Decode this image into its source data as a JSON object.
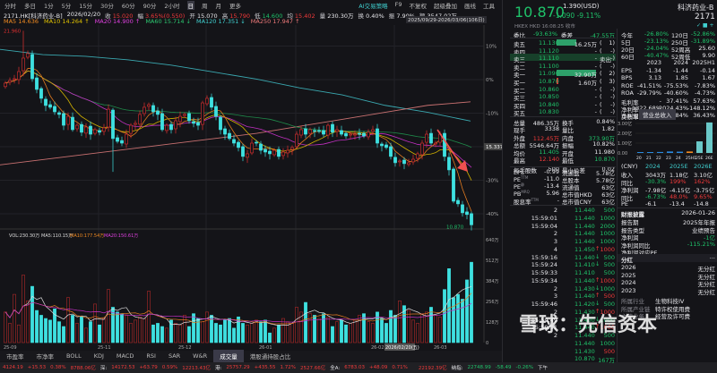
{
  "toolbar": {
    "periods": [
      "分时",
      "多日",
      "1分",
      "5分",
      "15分",
      "30分",
      "60分",
      "90分",
      "2小时",
      "日",
      "周",
      "月",
      "更多"
    ],
    "active": "日",
    "right": [
      "AI交易策略",
      "F9",
      "不复权",
      "超级叠加",
      "画线",
      "工具"
    ]
  },
  "info": {
    "symbol": "2171.HK[科济药业-B]",
    "date": "2026/02/20",
    "close_label": "收",
    "close": "15.020",
    "chg_label": "幅",
    "chg": "3.65%(0.550)",
    "open_label": "开",
    "open": "15.070",
    "high_label": "高",
    "high": "15.790",
    "low_label": "低",
    "low": "14.600",
    "avg_label": "均",
    "avg": "15.402",
    "vol_label": "量",
    "vol": "230.30万",
    "turn_label": "换",
    "turn": "0.40%",
    "amp_label": "振",
    "amp": "7.90%",
    "amt_label": "额",
    "amt": "3547.02万"
  },
  "ma_legend": [
    {
      "t": "MA5 14.636",
      "c": "#f08a20"
    },
    {
      "t": "MA10 14.264 ↑",
      "c": "#e0c200"
    },
    {
      "t": "MA20 14.900 ↑",
      "c": "#e040e0"
    },
    {
      "t": "MA60 15.714 ↓",
      "c": "#2cc870"
    },
    {
      "t": "MA120 17.351 ↓",
      "c": "#40d0d0"
    },
    {
      "t": "MA250 17.947 ↑",
      "c": "#f07a7a"
    }
  ],
  "range_label": "2025/09/29-2026/03/06(106日)",
  "colors": {
    "up": "#e03030",
    "down": "#3ee0e0",
    "bg": "#141418"
  },
  "chart_data": {
    "type": "candlestick",
    "base_price": 19.17,
    "high_marker": "21.960",
    "last_marker": "10.870",
    "current_price_label": "15.337",
    "pct_ticks": [
      "10%",
      "0%",
      "-10%",
      "-20%",
      "-30%",
      "-40%"
    ],
    "pct_values": [
      10,
      0,
      -10,
      -20,
      -30,
      -40
    ],
    "x_ticks": [
      "25-09",
      "25-11",
      "25-12",
      "26-01",
      "26-02",
      "26-03"
    ],
    "x_tick_index": [
      0,
      21,
      39,
      57,
      82,
      96
    ],
    "hover_date": "2026/02/20(五)",
    "hover_index": 88,
    "closes": [
      18.97,
      19.12,
      19.22,
      19.63,
      20.4,
      20.66,
      19.22,
      18.61,
      18.1,
      17.69,
      17.59,
      17.33,
      17.18,
      16.56,
      17.07,
      16.31,
      16.56,
      16.16,
      16.46,
      16.05,
      16.31,
      16.16,
      16.41,
      17.48,
      15.8,
      15.64,
      15.54,
      16.05,
      16.56,
      16.67,
      17.18,
      17.59,
      17.74,
      17.33,
      17.18,
      16.31,
      16.56,
      16.31,
      16.82,
      17.07,
      17.18,
      16.82,
      16.67,
      16.56,
      17.84,
      18.1,
      17.59,
      17.07,
      16.31,
      16.05,
      15.8,
      15.54,
      15.29,
      14.78,
      14.93,
      15.54,
      15.54,
      15.13,
      15.03,
      14.93,
      15.13,
      14.78,
      15.03,
      15.13,
      15.29,
      16.05,
      16.31,
      16.05,
      16.31,
      16.21,
      16.21,
      16.05,
      16.56,
      16.16,
      16.31,
      16.05,
      15.95,
      16.05,
      16.05,
      16.05,
      15.95,
      16.16,
      16.31,
      15.54,
      15.39,
      15.29,
      14.78,
      14.42,
      14.52,
      14.37,
      14.42,
      14.62,
      14.93,
      15.54,
      16.05,
      15.54,
      15.54,
      16.05,
      14.78,
      14.01,
      12.22,
      12.07,
      11.56,
      11.46,
      10.87
    ],
    "spike_index": 4,
    "spike_high": 21.96,
    "ma120": [
      20.9,
      20.6,
      20.5,
      20.3,
      20.0,
      19.6,
      19.2,
      18.7,
      18.3,
      17.7,
      17.3,
      16.8
    ],
    "ma250": [
      14.3,
      14.6,
      14.9,
      15.2,
      15.5,
      15.8,
      16.1,
      16.5,
      16.9,
      17.3,
      17.7,
      17.9
    ],
    "volume": {
      "title": "VOL:230.30万",
      "ma5": "MA5:110.15万",
      "ma10": "MA10:177.54万",
      "ma20": "MA20:150.61万",
      "ticks": [
        "640万",
        "512万",
        "384万",
        "256万",
        "128万",
        "0"
      ],
      "max": 640,
      "values": [
        190,
        120,
        300,
        110,
        420,
        260,
        350,
        200,
        170,
        150,
        140,
        210,
        130,
        100,
        280,
        170,
        120,
        160,
        90,
        130,
        240,
        110,
        150,
        330,
        220,
        190,
        180,
        170,
        120,
        140,
        160,
        150,
        320,
        110,
        120,
        100,
        90,
        140,
        120,
        110,
        170,
        100,
        180,
        150,
        130,
        190,
        170,
        120,
        110,
        140,
        150,
        90,
        160,
        120,
        110,
        120,
        140,
        130,
        140,
        60,
        90,
        110,
        150,
        130,
        120,
        220,
        190,
        250,
        180,
        170,
        150,
        180,
        160,
        100,
        130,
        140,
        110,
        120,
        140,
        170,
        180,
        130,
        120,
        190,
        150,
        120,
        200,
        170,
        260,
        230,
        200,
        140,
        120,
        180,
        190,
        220,
        170,
        160,
        330,
        460,
        280,
        300,
        270,
        390,
        500
      ]
    }
  },
  "tabs": {
    "items": [
      "市盈率",
      "市净率",
      "BOLL",
      "KDJ",
      "MACD",
      "RSI",
      "SAR",
      "W&R",
      "成交量",
      "港股通持股占比"
    ],
    "active": "成交量"
  },
  "ticker": [
    {
      "t": "4124.19",
      "c": "r"
    },
    {
      "t": "+15.53",
      "c": "r"
    },
    {
      "t": "0.38%",
      "c": "r"
    },
    {
      "t": "8788.06亿",
      "c": "r"
    },
    {
      "t": "深:",
      "c": "w"
    },
    {
      "t": "14172.53",
      "c": "r"
    },
    {
      "t": "+63.79",
      "c": "r"
    },
    {
      "t": "0.59%",
      "c": "r"
    },
    {
      "t": "12213.43亿",
      "c": "r"
    },
    {
      "t": "港:",
      "c": "w"
    },
    {
      "t": "25757.29",
      "c": "r"
    },
    {
      "t": "+435.55",
      "c": "r"
    },
    {
      "t": "1.72%",
      "c": "r"
    },
    {
      "t": "2527.66亿",
      "c": "r"
    },
    {
      "t": "全A:",
      "c": "w"
    },
    {
      "t": "6783.03",
      "c": "r"
    },
    {
      "t": "+48.09",
      "c": "r"
    },
    {
      "t": "0.71%",
      "c": "r"
    },
    {
      "t": "22192.39亿",
      "c": "r"
    },
    {
      "t": "纳指:",
      "c": "w"
    },
    {
      "t": "22748.99",
      "c": "g"
    },
    {
      "t": "-58.49",
      "c": "g"
    },
    {
      "t": "-0.26%",
      "c": "g"
    },
    {
      "t": "下午",
      "c": "w"
    }
  ],
  "quote": {
    "price": "10.870",
    "usd": "1.390(USD)",
    "change": "-1.090",
    "pct": "-9.11%",
    "name": "科济药业-B",
    "code": "2171",
    "market": "HKEX HKD 16:08:25 收市"
  },
  "book": {
    "wb_label": "委比",
    "wb": "-93.63%",
    "wc_label": "委差",
    "wc": "-47.55万",
    "asks": [
      [
        "卖五",
        "11.130",
        "16.25万",
        "(",
        "1)"
      ],
      [
        "卖四",
        "11.120",
        "-",
        "(",
        "-)"
      ],
      [
        "卖三",
        "11.110",
        "-",
        "卖出",
        "-)"
      ],
      [
        "卖二",
        "11.100",
        "-",
        "(",
        "-)"
      ],
      [
        "卖一",
        "11.090",
        "32.90万",
        "(",
        "2)"
      ]
    ],
    "bids": [
      [
        "买一",
        "10.870",
        "1.60万",
        "(",
        "3)"
      ],
      [
        "买二",
        "10.860",
        "-",
        "(",
        "-)"
      ],
      [
        "买三",
        "10.850",
        "-",
        "(",
        "-)"
      ],
      [
        "买四",
        "10.840",
        "-",
        "(",
        "-)"
      ],
      [
        "买五",
        "10.830",
        "-",
        "(",
        "-)"
      ]
    ]
  },
  "stats": [
    [
      "总量",
      "486.35万",
      "换手",
      "0.84%"
    ],
    [
      "现手",
      "3338",
      "量比",
      "1.82"
    ],
    [
      "外盘",
      "112.45万",
      "内盘",
      "373.90万"
    ],
    [
      "总额",
      "5546.64万",
      "振幅",
      "10.82%"
    ],
    [
      "均价",
      "11.405",
      "开盘",
      "11.980"
    ],
    [
      "最高",
      "12.140",
      "最低",
      "10.870"
    ],
    [
      "每手股数",
      "500",
      "最小价差",
      "0.02"
    ]
  ],
  "fund": [
    [
      "EPS",
      "TTM",
      "-0.99",
      "流通盘",
      "5.78亿"
    ],
    [
      "PE",
      "TTM",
      "-11.0",
      "总股本",
      "5.78亿"
    ],
    [
      "PE",
      "静",
      "-13.4",
      "流通值",
      "63亿"
    ],
    [
      "PB",
      "MRQ",
      "5.96",
      "总市值HKD",
      "63亿"
    ],
    [
      "股息率",
      "TTM",
      "-",
      "总市值CNY",
      "63亿"
    ]
  ],
  "trades": [
    [
      "2",
      "11.440",
      "",
      "500",
      "g"
    ],
    [
      "15:59:01",
      "11.440",
      "",
      "1000",
      "g"
    ],
    [
      "15:59:04",
      "11.440",
      "",
      "2000",
      "g"
    ],
    [
      "2",
      "11.440",
      "",
      "1000",
      "g"
    ],
    [
      "3",
      "11.440",
      "",
      "1000",
      "g"
    ],
    [
      "4",
      "11.450",
      "↑",
      "1000",
      "r"
    ],
    [
      "15:59:16",
      "11.440",
      "↓",
      "500",
      "g"
    ],
    [
      "15:59:24",
      "11.410",
      "↓",
      "500",
      "g"
    ],
    [
      "15:59:33",
      "11.410",
      "",
      "500",
      "g"
    ],
    [
      "15:59:34",
      "11.440",
      "↑",
      "1000",
      "r"
    ],
    [
      "2",
      "11.430",
      "↓",
      "1000",
      "g"
    ],
    [
      "3",
      "11.440",
      "↑",
      "500",
      "r"
    ],
    [
      "15:59:46",
      "11.420",
      "↓",
      "500",
      "g"
    ],
    [
      "2",
      "11.430",
      "↑",
      "1000",
      "r"
    ],
    [
      "15:59:49",
      "11.400",
      "↓",
      "1000",
      "g"
    ],
    [
      "15:59:51",
      "11.440",
      "↑",
      "1000",
      "r"
    ],
    [
      "2",
      "11.440",
      "",
      "500",
      "g"
    ],
    [
      "",
      "11.440",
      "",
      "1000",
      "g"
    ],
    [
      "",
      "11.430",
      "",
      "500",
      "r"
    ],
    [
      "",
      "10.870",
      "",
      "167万",
      "g"
    ]
  ],
  "perf": [
    [
      "今年",
      "-26.80%",
      "120日",
      "-52.86%"
    ],
    [
      "5日",
      "-23.13%",
      "250日",
      "-31.89%"
    ],
    [
      "20日",
      "-24.04%",
      "52周高",
      "25.60"
    ],
    [
      "60日",
      "-40.47%",
      "52周低",
      "9.90"
    ]
  ],
  "fin": {
    "headers": [
      "2023",
      "2024",
      "2025H1"
    ],
    "rows": [
      [
        "EPS",
        "-1.34",
        "-1.44",
        "-0.14"
      ],
      [
        "BPS",
        "3.13",
        "1.85",
        "1.67"
      ],
      [
        "ROE",
        "-41.51%",
        "-75.53%",
        "-7.83%"
      ],
      [
        "ROA",
        "-29.79%",
        "-40.60%",
        "-4.73%"
      ],
      [
        "毛利率",
        "-",
        "37.41%",
        "57.63%"
      ],
      [
        "净利率",
        "-1322.68%",
        "-2024.43%",
        "-148.12%"
      ],
      [
        "负债率",
        "20.18%",
        "36.84%",
        "36.43%"
      ]
    ],
    "np_label": "净利润",
    "rev_button": "营业总收入"
  },
  "rev_chart": {
    "type": "bar",
    "yticks": [
      "3.00亿",
      "2.00亿",
      "1.00亿",
      "0.00"
    ],
    "categories": [
      "20",
      "21",
      "22",
      "23",
      "24",
      "25H1",
      "25E",
      "26E"
    ],
    "values": [
      0.02,
      0.05,
      0.1,
      0.15,
      0.13,
      0.15,
      1.18,
      3.1
    ]
  },
  "forecast": {
    "headers": [
      "(CNY)",
      "2024",
      "2025E",
      "2026E"
    ],
    "rows": [
      [
        "收入",
        "3043万",
        "1.18亿",
        "3.10亿"
      ],
      [
        "同比",
        "-30.3%",
        "199%",
        "162%"
      ],
      [
        "净利润",
        "-7.98亿",
        "-4.15亿",
        "-3.75亿"
      ],
      [
        "同比",
        "-6.73%",
        "48.0%",
        "9.65%"
      ],
      [
        "PE",
        "-6.1",
        "-13.4",
        "-14.8"
      ]
    ]
  },
  "report": {
    "title": "财报披露",
    "date": "2026-01-26",
    "rows": [
      [
        "报告期",
        "2025年年报"
      ],
      [
        "报告类型",
        "业绩预告"
      ],
      [
        "净利润",
        "-1亿"
      ],
      [
        "净利润同比",
        "-115.21%"
      ],
      [
        "净利润对应PE",
        ""
      ]
    ]
  },
  "dividend": {
    "title": "分红",
    "more": "···",
    "rows": [
      [
        "2026",
        "无分红"
      ],
      [
        "2025",
        "无分红"
      ],
      [
        "2024",
        "无分红"
      ],
      [
        "2023",
        "无分红"
      ]
    ]
  },
  "industry": [
    [
      "所属行业",
      "生物科技IV"
    ],
    [
      "所属产业链",
      "特许权使用费"
    ],
    [
      "主营业务",
      "经营及许可费"
    ]
  ],
  "watermark": "雪球：先信资本"
}
